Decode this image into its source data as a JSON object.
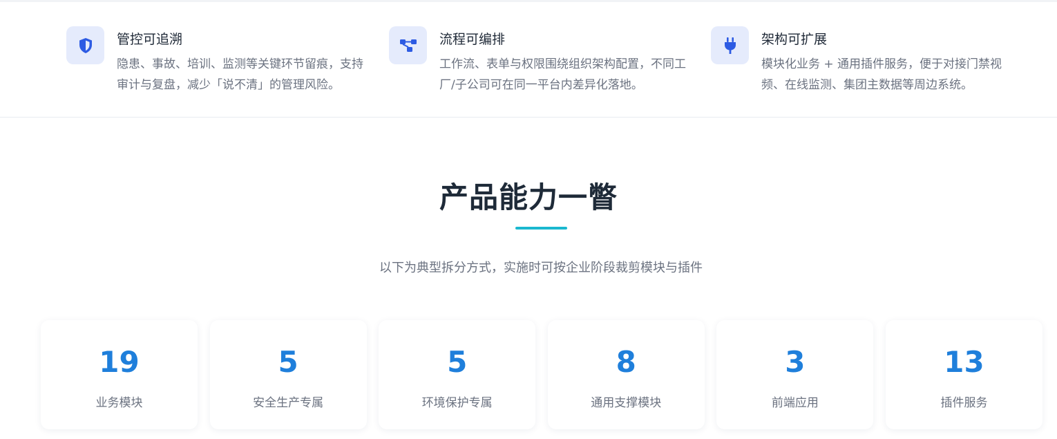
{
  "features": [
    {
      "icon": "shield-icon",
      "title": "管控可追溯",
      "desc_line1": "隐患、事故、培训、监测等关键环节留痕，支持",
      "desc_line2": "审计与复盘，减少「说不清」的管理风险。"
    },
    {
      "icon": "workflow-icon",
      "title": "流程可编排",
      "desc_line1": "工作流、表单与权限围绕组织架构配置，不同工",
      "desc_line2": "厂/子公司可在同一平台内差异化落地。"
    },
    {
      "icon": "plug-icon",
      "title": "架构可扩展",
      "desc_line1": "模块化业务 + 通用插件服务，便于对接门禁视",
      "desc_line2": "频、在线监测、集团主数据等周边系统。"
    }
  ],
  "section": {
    "title": "产品能力一瞥",
    "subtitle": "以下为典型拆分方式，实施时可按企业阶段裁剪模块与插件"
  },
  "stats": [
    {
      "value": "19",
      "label": "业务模块"
    },
    {
      "value": "5",
      "label": "安全生产专属"
    },
    {
      "value": "5",
      "label": "环境保护专属"
    },
    {
      "value": "8",
      "label": "通用支撑模块"
    },
    {
      "value": "3",
      "label": "前端应用"
    },
    {
      "value": "13",
      "label": "插件服务"
    }
  ],
  "colors": {
    "accent_blue": "#1f7fdb",
    "icon_blue": "#2d5be3",
    "icon_bg": "#e5ebfc",
    "underline_cyan": "#1bb8cf"
  }
}
